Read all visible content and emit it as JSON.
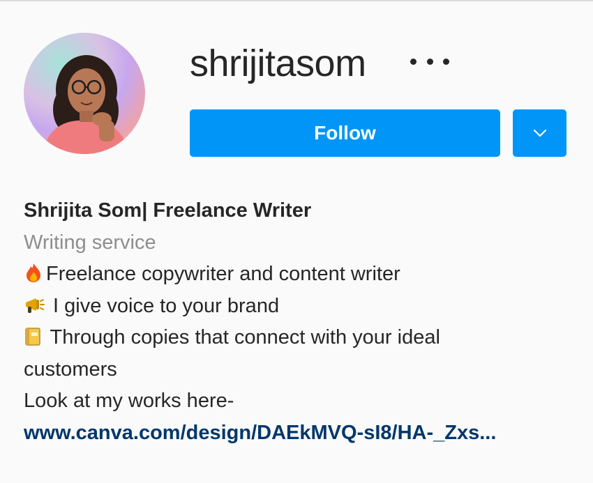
{
  "profile": {
    "username": "shrijitasom",
    "follow_label": "Follow",
    "full_name": "Shrijita Som| Freelance Writer",
    "category": "Writing service",
    "bio": {
      "line1": "Freelance copywriter and content writer",
      "line2": " I give voice to your brand",
      "line3": " Through copies that connect with your ideal",
      "line4": "customers",
      "line5": "Look at my works here-"
    },
    "link": "www.canva.com/design/DAEkMVQ-sI8/HA-_Zxs..."
  },
  "icons": {
    "line1": "fire-icon",
    "line2": "megaphone-icon",
    "line3": "notebook-icon",
    "more": "more-options-icon",
    "dropdown": "chevron-down-icon"
  },
  "colors": {
    "primary_button": "#0095f6",
    "link": "#00376b",
    "secondary_text": "#8e8e8e",
    "background": "#fafafa"
  }
}
